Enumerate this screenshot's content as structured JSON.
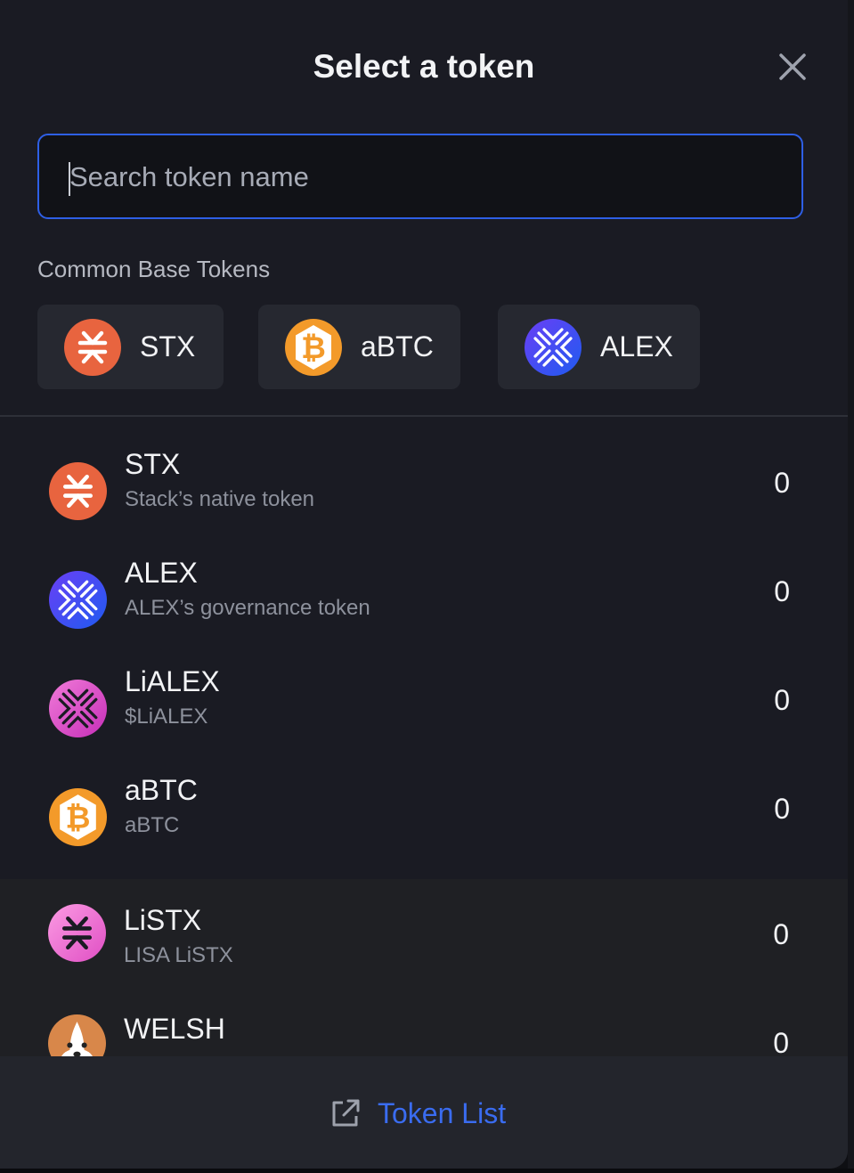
{
  "modal": {
    "title": "Select a token",
    "close_icon": "close-icon"
  },
  "search": {
    "placeholder": "Search token name",
    "value": ""
  },
  "common": {
    "label": "Common Base Tokens",
    "chips": [
      {
        "symbol": "STX",
        "icon": "stx-icon"
      },
      {
        "symbol": "aBTC",
        "icon": "abtc-icon"
      },
      {
        "symbol": "ALEX",
        "icon": "alex-icon"
      }
    ]
  },
  "tokens": [
    {
      "symbol": "STX",
      "description": "Stack’s native token",
      "balance": "0",
      "icon": "stx-icon"
    },
    {
      "symbol": "ALEX",
      "description": "ALEX’s governance token",
      "balance": "0",
      "icon": "alex-icon"
    },
    {
      "symbol": "LiALEX",
      "description": "$LiALEX",
      "balance": "0",
      "icon": "lialex-icon"
    },
    {
      "symbol": "aBTC",
      "description": "aBTC",
      "balance": "0",
      "icon": "abtc-icon"
    },
    {
      "symbol": "LiSTX",
      "description": "LISA LiSTX",
      "balance": "0",
      "icon": "listx-icon"
    },
    {
      "symbol": "WELSH",
      "description": "",
      "balance": "0",
      "icon": "welsh-icon"
    }
  ],
  "footer": {
    "link_label": "Token List",
    "icon": "external-link-icon"
  },
  "colors": {
    "accent": "#2e5fe5",
    "link": "#3a6cf0",
    "stx": "#e8643f",
    "btc": "#f39a2a",
    "alex": "#3b4af0",
    "lialex": "#d93ec6",
    "listx": "#f06bd0"
  }
}
